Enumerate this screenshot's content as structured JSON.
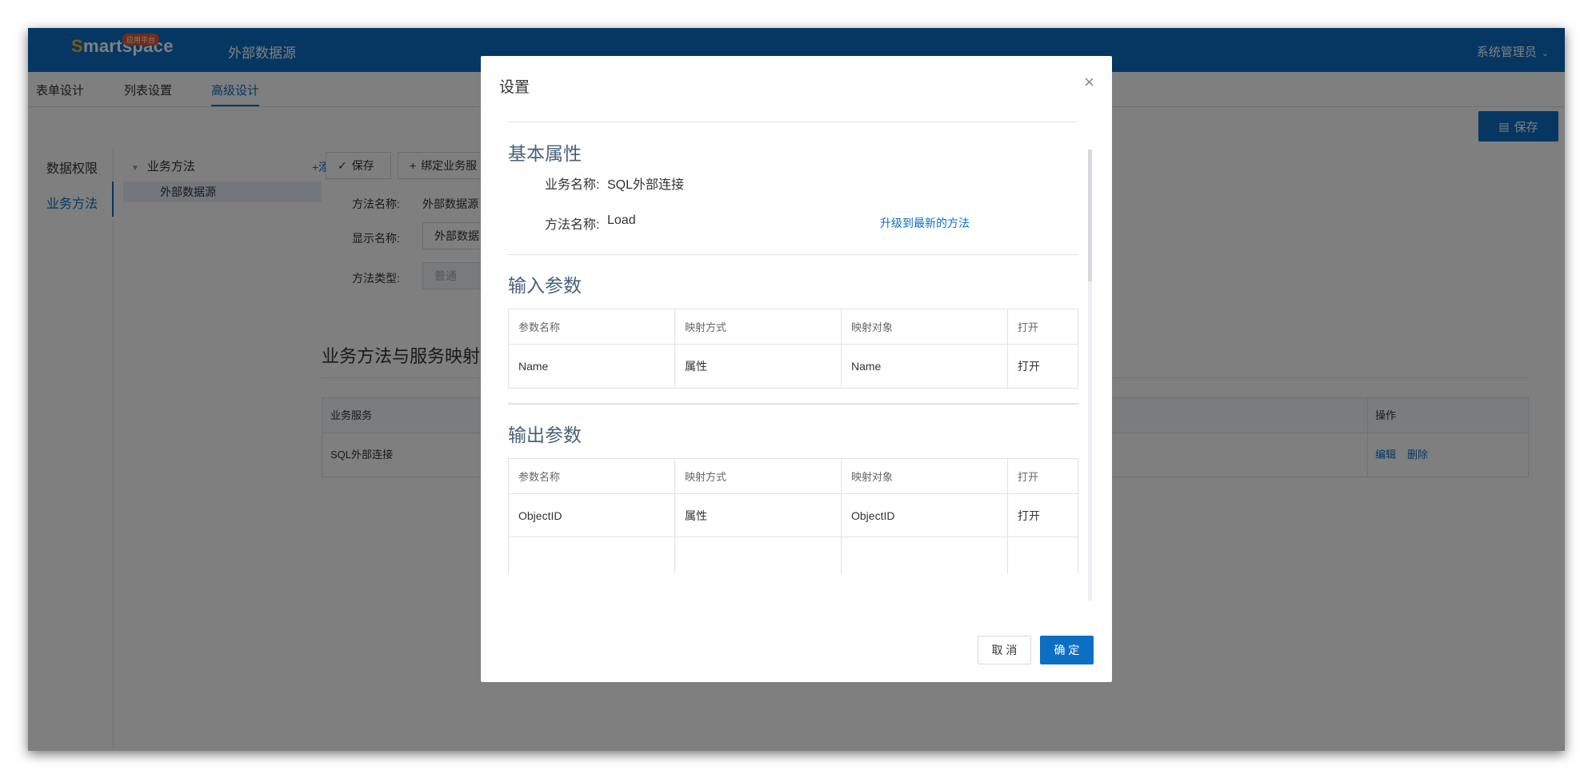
{
  "header": {
    "logo_text": "martspace",
    "logo_s": "S",
    "logo_badge": "应用平台",
    "app_title": "外部数据源",
    "user_menu": "系统管理员"
  },
  "tabs": [
    {
      "label": "表单设计"
    },
    {
      "label": "列表设置"
    },
    {
      "label": "高级设计"
    }
  ],
  "toolbar": {
    "save_top": "保存",
    "save": "保存",
    "bind_service": "绑定业务服"
  },
  "leftnav": [
    {
      "label": "数据权限"
    },
    {
      "label": "业务方法"
    }
  ],
  "tree": {
    "root": "业务方法",
    "add": "+添加",
    "child": "外部数据源"
  },
  "form": {
    "method_name_label": "方法名称:",
    "method_name_value": "外部数据源",
    "display_name_label": "显示名称:",
    "display_name_value": "外部数据",
    "method_type_label": "方法类型:",
    "method_type_value": "普通"
  },
  "mapping_section": {
    "title": "业务方法与服务映射",
    "col_service": "业务服务",
    "col_action": "操作",
    "row_service": "SQL外部连接",
    "row_edit": "编辑",
    "row_delete": "删除"
  },
  "modal": {
    "title": "设置",
    "close_glyph": "×",
    "basic_title": "基本属性",
    "business_name_label": "业务名称:",
    "business_name_value": "SQL外部连接",
    "method_name_label": "方法名称:",
    "method_name_value": "Load",
    "upgrade_link": "升级到最新的方法",
    "input_title": "输入参数",
    "output_title": "输出参数",
    "columns": [
      "参数名称",
      "映射方式",
      "映射对象",
      "打开"
    ],
    "input_rows": [
      {
        "name": "Name",
        "mode": "属性",
        "target": "Name",
        "open": "打开"
      }
    ],
    "output_rows": [
      {
        "name": "ObjectID",
        "mode": "属性",
        "target": "ObjectID",
        "open": "打开"
      }
    ],
    "cancel": "取 消",
    "ok": "确 定"
  },
  "colors": {
    "primary": "#0b6fc4",
    "mask": "rgba(0,0,0,0.5)"
  }
}
